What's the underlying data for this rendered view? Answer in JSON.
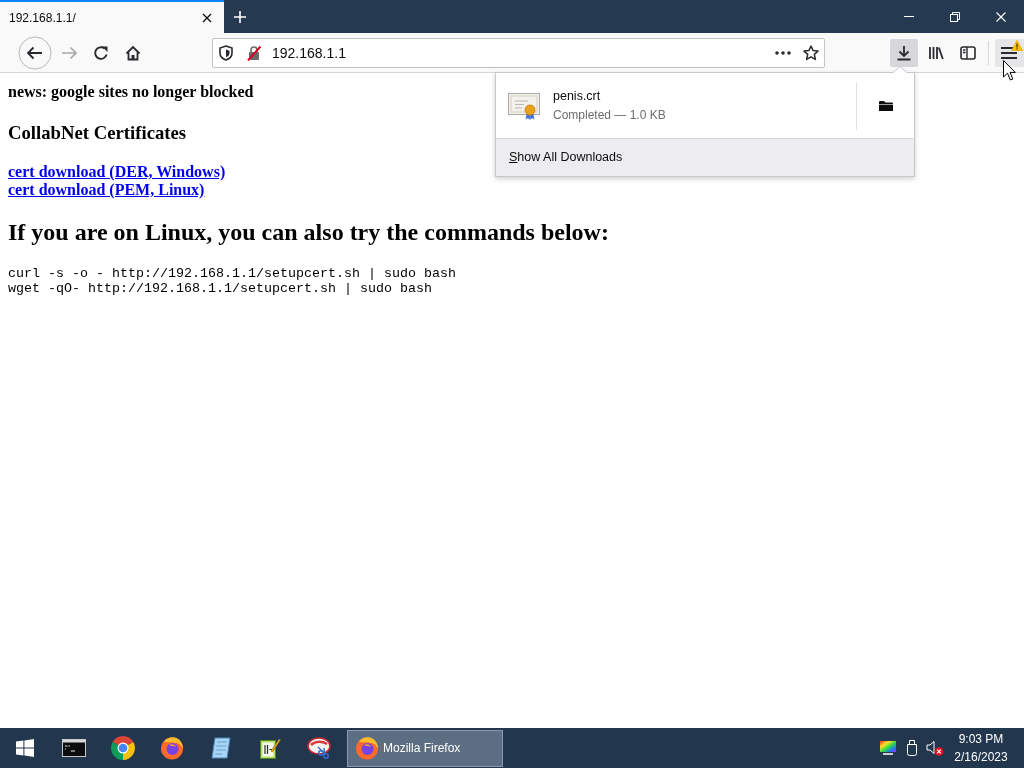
{
  "window": {
    "tabs": [
      {
        "title": "192.168.1.1/",
        "selected": true
      }
    ]
  },
  "toolbar": {
    "nav_buttons": [
      {
        "kind": "back",
        "disabled": false
      },
      {
        "kind": "forward",
        "disabled": true
      },
      {
        "kind": "reload",
        "disabled": false
      },
      {
        "kind": "home",
        "disabled": false
      }
    ],
    "address": "192.168.1.1",
    "downloads_open": true,
    "menu_alert": true
  },
  "page": {
    "news": "news: google sites no longer blocked",
    "heading": "CollabNet Certificates",
    "links": [
      "cert download (DER, Windows)",
      "cert download (PEM, Linux)"
    ],
    "subheading": "If you are on Linux, you can also try the commands below:",
    "commands": [
      "curl -s -o - http://192.168.1.1/setupcert.sh | sudo bash",
      "wget -qO- http://192.168.1.1/setupcert.sh | sudo bash"
    ]
  },
  "downloads_panel": {
    "items": [
      {
        "name": "penis.crt",
        "status": "Completed — 1.0 KB"
      }
    ],
    "footer": "Show All Downloads"
  },
  "taskbar": {
    "buttons": [
      {
        "kind": "start",
        "selected": false
      },
      {
        "kind": "terminal",
        "selected": false
      },
      {
        "kind": "chrome",
        "selected": false
      },
      {
        "kind": "firefox",
        "selected": false
      },
      {
        "kind": "notepad",
        "selected": false
      },
      {
        "kind": "notebook",
        "selected": false
      },
      {
        "kind": "paint",
        "selected": false
      },
      {
        "kind": "firefox",
        "label": "Mozilla Firefox",
        "selected": true
      }
    ],
    "tray": {
      "muted": true,
      "time": "9:03 PM",
      "date": "2/16/2023"
    }
  }
}
